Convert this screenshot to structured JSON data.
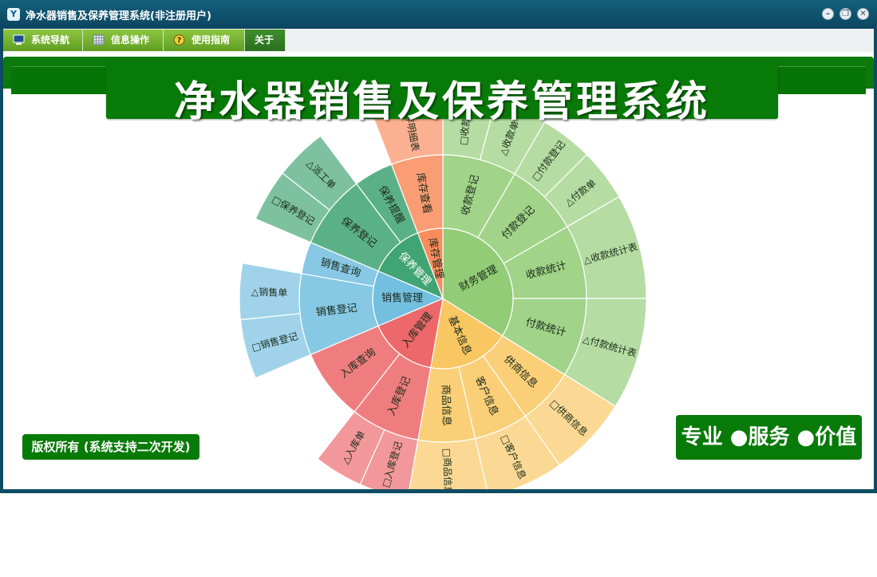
{
  "window": {
    "title": "净水器销售及保养管理系统(非注册用户)",
    "app_icon": "Y"
  },
  "menu": {
    "items": [
      {
        "label": "系统导航",
        "icon": "monitor-icon"
      },
      {
        "label": "信息操作",
        "icon": "grid-icon"
      },
      {
        "label": "使用指南",
        "icon": "help-icon"
      },
      {
        "label": "关于",
        "icon": ""
      }
    ]
  },
  "banner": {
    "title": "净水器销售及保养管理系统"
  },
  "footer": {
    "copyright": "版权所有 (系统支持二次开发)",
    "slogan": "专业 ●服务 ●价值"
  },
  "colors": {
    "accent_green": "#087a08",
    "finance": "#8dc870",
    "basic": "#f6c45e",
    "stock_in": "#ec6a6b",
    "sales": "#6cbde0",
    "maintenance": "#43a876",
    "inventory": "#f98b5c"
  },
  "chart_data": {
    "type": "sunburst",
    "center": "",
    "sectors": [
      {
        "name": "财务管理",
        "color": "#92cc76",
        "angle_start": 0,
        "angle_end": 122,
        "children": [
          {
            "name": "收款登记",
            "angle_start": 0,
            "angle_end": 30,
            "children": [
              {
                "name": "□收款单",
                "angle_start": 0,
                "angle_end": 15
              },
              {
                "name": "△收款单",
                "angle_start": 15,
                "angle_end": 30
              }
            ]
          },
          {
            "name": "付款登记",
            "angle_start": 30,
            "angle_end": 60,
            "children": [
              {
                "name": "□付款登记",
                "angle_start": 30,
                "angle_end": 45
              },
              {
                "name": "△付款单",
                "angle_start": 45,
                "angle_end": 60
              }
            ]
          },
          {
            "name": "收款统计",
            "angle_start": 60,
            "angle_end": 90,
            "children": [
              {
                "name": "△收款统计表",
                "angle_start": 60,
                "angle_end": 90
              }
            ]
          },
          {
            "name": "付款统计",
            "angle_start": 90,
            "angle_end": 122,
            "children": [
              {
                "name": "△付款统计表",
                "angle_start": 90,
                "angle_end": 122
              }
            ]
          }
        ]
      },
      {
        "name": "基本信息",
        "color": "#f9c762",
        "angle_start": 122,
        "angle_end": 190,
        "children": [
          {
            "name": "供商信息",
            "angle_start": 122,
            "angle_end": 145,
            "children": [
              {
                "name": "□供商信息",
                "angle_start": 122,
                "angle_end": 145
              }
            ]
          },
          {
            "name": "客户信息",
            "angle_start": 145,
            "angle_end": 167,
            "children": [
              {
                "name": "□客户信息",
                "angle_start": 145,
                "angle_end": 167
              }
            ]
          },
          {
            "name": "商品信息",
            "angle_start": 167,
            "angle_end": 190,
            "children": [
              {
                "name": "□商品信息",
                "angle_start": 167,
                "angle_end": 190
              }
            ]
          }
        ]
      },
      {
        "name": "入库管理",
        "color": "#ec686a",
        "angle_start": 190,
        "angle_end": 247,
        "children": [
          {
            "name": "入库登记",
            "angle_start": 190,
            "angle_end": 218,
            "children": [
              {
                "name": "□入库登记",
                "angle_start": 190,
                "angle_end": 204
              },
              {
                "name": "△入库单",
                "angle_start": 204,
                "angle_end": 218
              }
            ]
          },
          {
            "name": "入库查询",
            "angle_start": 218,
            "angle_end": 247,
            "children": []
          }
        ]
      },
      {
        "name": "销售管理",
        "color": "#73bfe0",
        "angle_start": 247,
        "angle_end": 293,
        "children": [
          {
            "name": "销售登记",
            "angle_start": 247,
            "angle_end": 280,
            "children": [
              {
                "name": "□销售登记",
                "angle_start": 247,
                "angle_end": 264
              },
              {
                "name": "△销售单",
                "angle_start": 264,
                "angle_end": 280
              }
            ]
          },
          {
            "name": "销售查询",
            "angle_start": 280,
            "angle_end": 293,
            "children": []
          }
        ]
      },
      {
        "name": "保养管理",
        "color": "#40a473",
        "angle_start": 293,
        "angle_end": 339,
        "children": [
          {
            "name": "保养登记",
            "angle_start": 293,
            "angle_end": 323,
            "children": [
              {
                "name": "□保养登记",
                "angle_start": 293,
                "angle_end": 308
              },
              {
                "name": "△派工单",
                "angle_start": 308,
                "angle_end": 323
              }
            ]
          },
          {
            "name": "保养提醒",
            "angle_start": 323,
            "angle_end": 339,
            "children": []
          }
        ]
      },
      {
        "name": "库存管理",
        "color": "#f98c5d",
        "angle_start": 339,
        "angle_end": 360,
        "children": [
          {
            "name": "库存查看",
            "angle_start": 339,
            "angle_end": 360,
            "children": [
              {
                "name": "库存明细表",
                "angle_start": 339,
                "angle_end": 360
              }
            ]
          }
        ]
      }
    ]
  }
}
